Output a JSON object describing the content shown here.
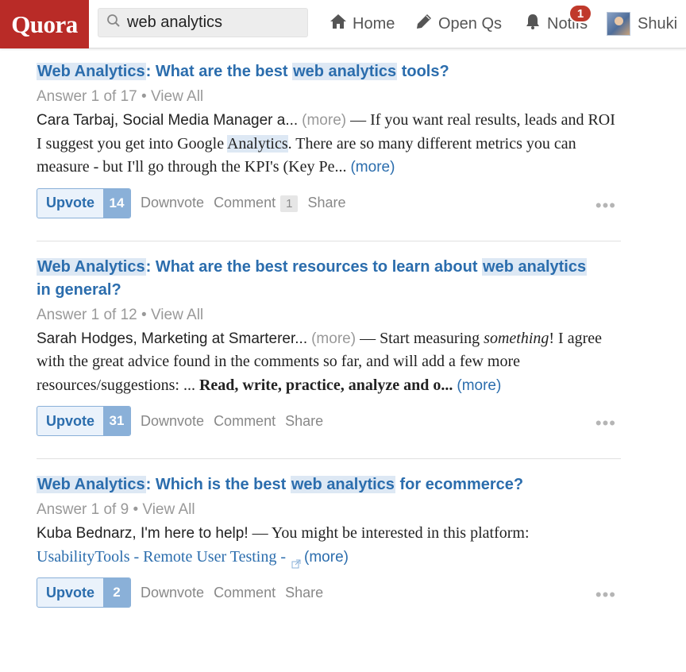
{
  "header": {
    "logo": "Quora",
    "search_value": "web analytics",
    "nav": {
      "home": "Home",
      "open_qs": "Open Qs",
      "notifs": "Notifs",
      "notifs_badge": "1",
      "user": "Shuki"
    }
  },
  "items": [
    {
      "topic": "Web Analytics",
      "q_pre": "What are the best ",
      "q_hl": "web analytics",
      "q_post": " tools?",
      "q_line2": "",
      "answer_count": "Answer 1 of 17",
      "view_all": "• View All",
      "author": "Cara Tarbaj, Social Media Manager a...",
      "author_more": "(more)",
      "dash": " — ",
      "text_a": "If you want real results, leads and ROI I suggest you get into Google ",
      "text_hl": "Analytics",
      "text_b": ". There are so many different metrics you can measure - but I'll go through the KPI's (Key Pe...",
      "more": "(more)",
      "upvote_label": "Upvote",
      "upvote_count": "14",
      "downvote": "Downvote",
      "comment": "Comment",
      "comment_count": "1",
      "share": "Share"
    },
    {
      "topic": "Web Analytics",
      "q_pre": "What are the best resources to learn about ",
      "q_hl": "web analytics",
      "q_post": "",
      "q_line2": "in general?",
      "answer_count": "Answer 1 of 12",
      "view_all": "• View All",
      "author": "Sarah Hodges, Marketing at Smarterer...",
      "author_more": "(more)",
      "dash": " — ",
      "text_a": "Start measuring ",
      "text_em": "something",
      "text_b": "! I agree with the great advice found in the comments so far, and will add a few more resources/suggestions:  ... ",
      "text_bold": "Read, write, practice, analyze and o...",
      "more": "(more)",
      "upvote_label": "Upvote",
      "upvote_count": "31",
      "downvote": "Downvote",
      "comment": "Comment",
      "share": "Share"
    },
    {
      "topic": "Web Analytics",
      "q_pre": "Which is the best ",
      "q_hl": "web analytics",
      "q_post": " for ecommerce?",
      "answer_count": "Answer 1 of 9",
      "view_all": "• View All",
      "author": "Kuba Bednarz, I'm here to help!",
      "dash": " — ",
      "text_a": "You might be interested in this platform: ",
      "link": "UsabilityTools - Remote User Testing - ",
      "more": "(more)",
      "upvote_label": "Upvote",
      "upvote_count": "2",
      "downvote": "Downvote",
      "comment": "Comment",
      "share": "Share"
    }
  ],
  "more_actions": "•••",
  "colors": {
    "brand": "#b92b27",
    "link": "#2b6dad",
    "highlight": "#dde8f4",
    "upvote_border": "#8ab0d8",
    "badge": "#c0392b"
  }
}
